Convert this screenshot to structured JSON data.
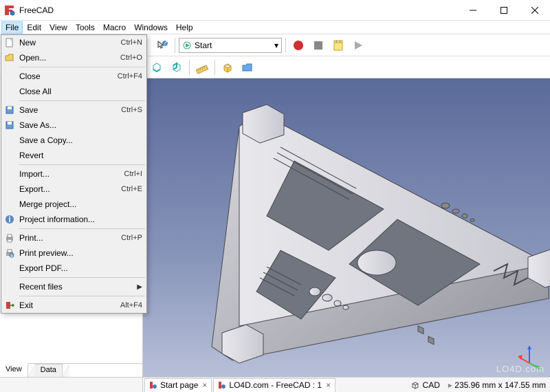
{
  "window": {
    "title": "FreeCAD"
  },
  "menubar": [
    "File",
    "Edit",
    "View",
    "Tools",
    "Macro",
    "Windows",
    "Help"
  ],
  "workbench": {
    "selected": "Start"
  },
  "file_menu": [
    {
      "icon": "doc-new",
      "label": "New",
      "shortcut": "Ctrl+N"
    },
    {
      "icon": "folder",
      "label": "Open...",
      "shortcut": "Ctrl+O"
    },
    {
      "sep": true
    },
    {
      "label": "Close",
      "shortcut": "Ctrl+F4"
    },
    {
      "label": "Close All"
    },
    {
      "sep": true
    },
    {
      "icon": "disk",
      "label": "Save",
      "shortcut": "Ctrl+S"
    },
    {
      "icon": "disk",
      "label": "Save As..."
    },
    {
      "label": "Save a Copy..."
    },
    {
      "label": "Revert"
    },
    {
      "sep": true
    },
    {
      "label": "Import...",
      "shortcut": "Ctrl+I"
    },
    {
      "label": "Export...",
      "shortcut": "Ctrl+E"
    },
    {
      "label": "Merge project..."
    },
    {
      "icon": "info",
      "label": "Project information..."
    },
    {
      "sep": true
    },
    {
      "icon": "print",
      "label": "Print...",
      "shortcut": "Ctrl+P"
    },
    {
      "icon": "print-prev",
      "label": "Print preview..."
    },
    {
      "label": "Export PDF..."
    },
    {
      "sep": true
    },
    {
      "label": "Recent files",
      "submenu": true
    },
    {
      "sep": true
    },
    {
      "icon": "exit",
      "label": "Exit",
      "shortcut": "Alt+F4"
    }
  ],
  "side_tabs": {
    "view": "View",
    "data": "Data"
  },
  "doc_tabs": [
    {
      "label": "Start page"
    },
    {
      "label": "LO4D.com - FreeCAD : 1"
    }
  ],
  "statusbar": {
    "cad_label": "CAD",
    "dimensions": "235.96 mm x 147.55 mm"
  },
  "watermark": "LO4D.com"
}
